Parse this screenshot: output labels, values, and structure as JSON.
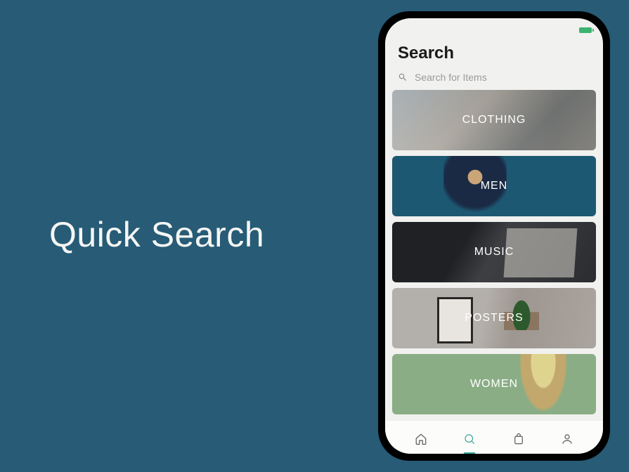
{
  "hero": {
    "title": "Quick Search"
  },
  "screen": {
    "title": "Search",
    "search_placeholder": "Search for Items"
  },
  "categories": [
    {
      "label": "CLOTHING"
    },
    {
      "label": "MEN"
    },
    {
      "label": "MUSIC"
    },
    {
      "label": "POSTERS"
    },
    {
      "label": "WOMEN"
    }
  ],
  "nav": {
    "items": [
      {
        "name": "home",
        "active": false
      },
      {
        "name": "search",
        "active": true
      },
      {
        "name": "bag",
        "active": false
      },
      {
        "name": "profile",
        "active": false
      }
    ]
  }
}
